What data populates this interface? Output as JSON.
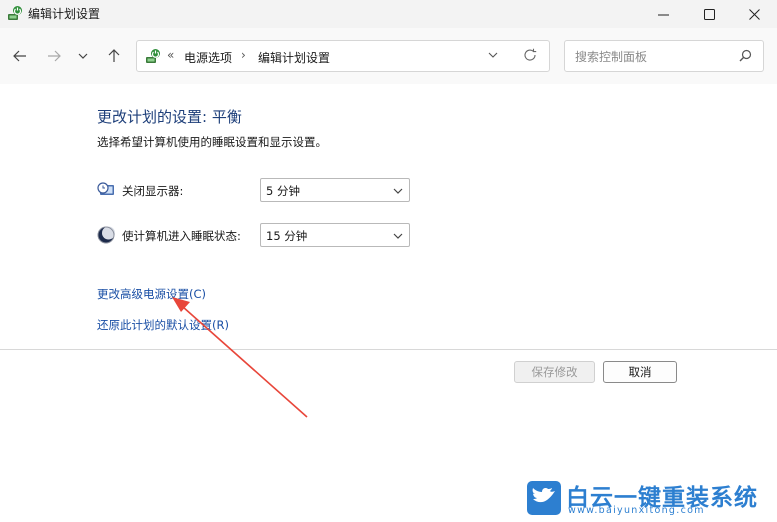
{
  "window": {
    "title": "编辑计划设置"
  },
  "address": {
    "overflow": "«",
    "segments": [
      "电源选项",
      "编辑计划设置"
    ]
  },
  "search": {
    "placeholder": "搜索控制面板"
  },
  "main": {
    "heading": "更改计划的设置: 平衡",
    "subtext": "选择希望计算机使用的睡眠设置和显示设置。",
    "settings": [
      {
        "label": "关闭显示器:",
        "value": "5 分钟",
        "icon": "monitor-clock-icon"
      },
      {
        "label": "使计算机进入睡眠状态:",
        "value": "15 分钟",
        "icon": "moon-icon"
      }
    ],
    "links": {
      "advanced": "更改高级电源设置(C)",
      "restore": "还原此计划的默认设置(R)"
    }
  },
  "buttons": {
    "save": "保存修改",
    "cancel": "取消"
  },
  "watermark": {
    "title": "白云一键重装系统",
    "url": "www.baiyunxitong.com"
  },
  "colors": {
    "heading": "#1e3f7a",
    "link": "#1a4fa5",
    "annotation_arrow": "#e8463a",
    "watermark": "#2d7fd0"
  }
}
